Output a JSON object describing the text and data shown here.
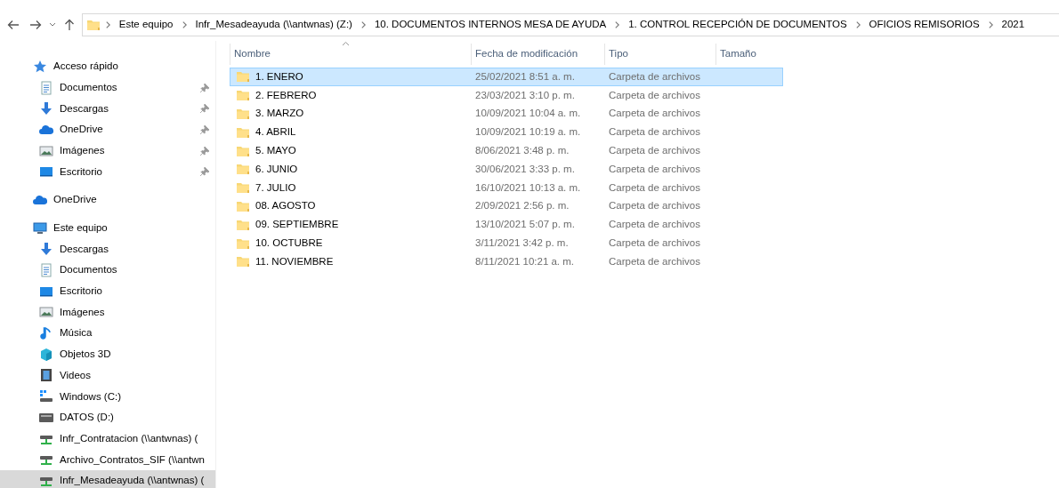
{
  "toolbar": {
    "breadcrumb": [
      "Este equipo",
      "Infr_Mesadeayuda (\\\\antwnas) (Z:)",
      "10. DOCUMENTOS INTERNOS MESA DE AYUDA",
      "1. CONTROL RECEPCIÓN DE DOCUMENTOS",
      "OFICIOS REMISORIOS",
      "2021"
    ]
  },
  "sidebar": {
    "items": [
      {
        "label": "Acceso rápido",
        "kind": "star",
        "selected": false,
        "children": [
          {
            "label": "Documentos",
            "kind": "doc",
            "pinned": true,
            "selected": false
          },
          {
            "label": "Descargas",
            "kind": "download",
            "pinned": true,
            "selected": false
          },
          {
            "label": "OneDrive",
            "kind": "cloud",
            "pinned": true,
            "selected": false
          },
          {
            "label": "Imágenes",
            "kind": "image",
            "pinned": true,
            "selected": false
          },
          {
            "label": "Escritorio",
            "kind": "desktop",
            "pinned": true,
            "selected": false
          }
        ]
      },
      {
        "label": "OneDrive",
        "kind": "cloud",
        "selected": false
      },
      {
        "label": "Este equipo",
        "kind": "pc",
        "selected": false,
        "children": [
          {
            "label": "Descargas",
            "kind": "download",
            "pinned": false,
            "selected": false
          },
          {
            "label": "Documentos",
            "kind": "doc",
            "pinned": false,
            "selected": false
          },
          {
            "label": "Escritorio",
            "kind": "desktop",
            "pinned": false,
            "selected": false
          },
          {
            "label": "Imágenes",
            "kind": "image",
            "pinned": false,
            "selected": false
          },
          {
            "label": "Música",
            "kind": "music",
            "pinned": false,
            "selected": false
          },
          {
            "label": "Objetos 3D",
            "kind": "cube",
            "pinned": false,
            "selected": false
          },
          {
            "label": "Videos",
            "kind": "video",
            "pinned": false,
            "selected": false
          },
          {
            "label": "Windows (C:)",
            "kind": "windrive",
            "pinned": false,
            "selected": false
          },
          {
            "label": "DATOS (D:)",
            "kind": "drive",
            "pinned": false,
            "selected": false
          },
          {
            "label": "Infr_Contratacion (\\\\antwnas) (",
            "kind": "netdrive",
            "pinned": false,
            "selected": false
          },
          {
            "label": "Archivo_Contratos_SIF (\\\\antwn",
            "kind": "netdrive",
            "pinned": false,
            "selected": false
          },
          {
            "label": "Infr_Mesadeayuda (\\\\antwnas) (",
            "kind": "netdrive",
            "pinned": false,
            "selected": true
          }
        ]
      }
    ]
  },
  "table": {
    "columns": [
      "Nombre",
      "Fecha de modificación",
      "Tipo",
      "Tamaño"
    ],
    "rows": [
      {
        "name": "1. ENERO",
        "date": "25/02/2021 8:51 a. m.",
        "type": "Carpeta de archivos",
        "selected": true
      },
      {
        "name": "2. FEBRERO",
        "date": "23/03/2021 3:10 p. m.",
        "type": "Carpeta de archivos",
        "selected": false
      },
      {
        "name": "3. MARZO",
        "date": "10/09/2021 10:04 a. m.",
        "type": "Carpeta de archivos",
        "selected": false
      },
      {
        "name": "4. ABRIL",
        "date": "10/09/2021 10:19 a. m.",
        "type": "Carpeta de archivos",
        "selected": false
      },
      {
        "name": "5. MAYO",
        "date": "8/06/2021 3:48 p. m.",
        "type": "Carpeta de archivos",
        "selected": false
      },
      {
        "name": "6. JUNIO",
        "date": "30/06/2021 3:33 p. m.",
        "type": "Carpeta de archivos",
        "selected": false
      },
      {
        "name": "7. JULIO",
        "date": "16/10/2021 10:13 a. m.",
        "type": "Carpeta de archivos",
        "selected": false
      },
      {
        "name": "08. AGOSTO",
        "date": "2/09/2021 2:56 p. m.",
        "type": "Carpeta de archivos",
        "selected": false
      },
      {
        "name": "09. SEPTIEMBRE",
        "date": "13/10/2021 5:07 p. m.",
        "type": "Carpeta de archivos",
        "selected": false
      },
      {
        "name": "10. OCTUBRE",
        "date": "3/11/2021 3:42 p. m.",
        "type": "Carpeta de archivos",
        "selected": false
      },
      {
        "name": "11. NOVIEMBRE",
        "date": "8/11/2021 10:21 a. m.",
        "type": "Carpeta de archivos",
        "selected": false
      }
    ]
  }
}
